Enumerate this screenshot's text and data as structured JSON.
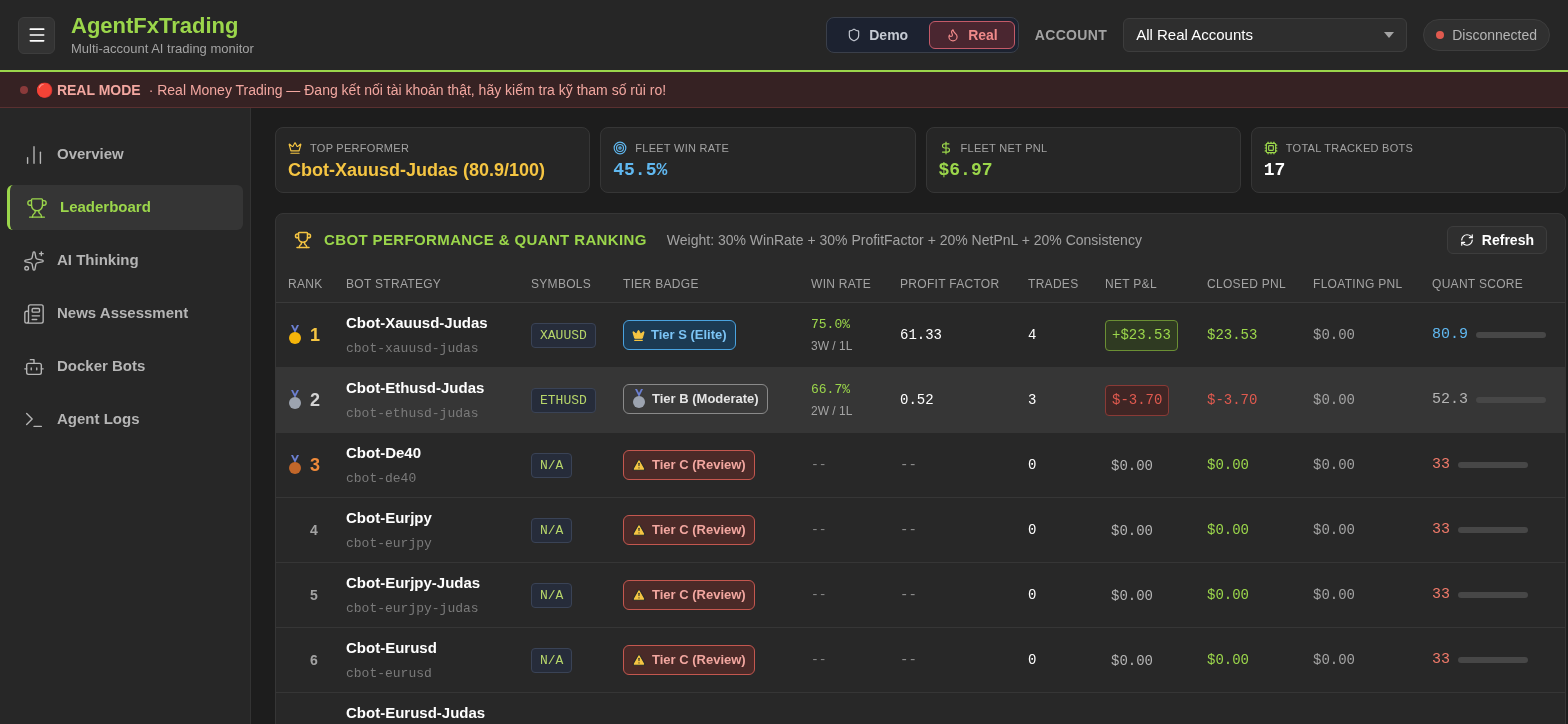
{
  "app": {
    "title": "AgentFxTrading",
    "subtitle": "Multi-account AI trading monitor"
  },
  "mode_toggle": [
    {
      "label": "Demo",
      "kind": "demo",
      "selected": false
    },
    {
      "label": "Real",
      "kind": "real",
      "selected": true
    }
  ],
  "account": {
    "label": "ACCOUNT",
    "value": "All Real Accounts"
  },
  "connection": {
    "label": "Disconnected",
    "connected": false
  },
  "banner": {
    "title": "🔴 REAL MODE",
    "text": "· Real Money Trading — Đang kết nối tài khoản thật, hãy kiểm tra kỹ tham số rủi ro!"
  },
  "sidebar": {
    "items": [
      {
        "label": "Overview",
        "kind": "chart",
        "selected": false
      },
      {
        "label": "Leaderboard",
        "kind": "trophy",
        "selected": true
      },
      {
        "label": "AI Thinking",
        "kind": "sparkles",
        "selected": false
      },
      {
        "label": "News Assessment",
        "kind": "news",
        "selected": false
      },
      {
        "label": "Docker Bots",
        "kind": "bot",
        "selected": false
      },
      {
        "label": "Agent Logs",
        "kind": "terminal",
        "selected": false
      }
    ]
  },
  "stats": [
    {
      "label": "TOP PERFORMER",
      "value": "Cbot-Xauusd-Judas (80.9/100)",
      "kind": "crown"
    },
    {
      "label": "FLEET WIN RATE",
      "value": "45.5%",
      "kind": "target"
    },
    {
      "label": "FLEET NET PNL",
      "value": "$6.97",
      "kind": "dollar"
    },
    {
      "label": "TOTAL TRACKED BOTS",
      "value": "17",
      "kind": "chip"
    }
  ],
  "ranking": {
    "title": "CBOT PERFORMANCE & QUANT RANKING",
    "weight_note": "Weight: 30% WinRate + 30% ProfitFactor + 20% NetPnL + 20% Consistency",
    "refresh_button": "Refresh",
    "columns": [
      "RANK",
      "BOT STRATEGY",
      "SYMBOLS",
      "TIER BADGE",
      "WIN RATE",
      "PROFIT FACTOR",
      "TRADES",
      "NET P&L",
      "CLOSED PNL",
      "FLOATING PNL",
      "QUANT SCORE"
    ],
    "rows": [
      {
        "rank": "1",
        "kind": "gold",
        "selected": false,
        "name": "Cbot-Xauusd-Judas",
        "slug": "cbot-xauusd-judas",
        "symbol": "XAUUSD",
        "tier": {
          "label": "Tier S (Elite)",
          "kind": "elite"
        },
        "win_rate": "75.0%",
        "record": "3W / 1L",
        "profit_factor": "61.33",
        "trades": "4",
        "net_pnl": {
          "text": "+$23.53",
          "kind": "gain"
        },
        "closed_pnl": {
          "text": "$23.53",
          "kind": "gain"
        },
        "floating_pnl": "$0.00",
        "score": {
          "text": "80.9",
          "kind": "high"
        }
      },
      {
        "rank": "2",
        "kind": "silver",
        "selected": true,
        "name": "Cbot-Ethusd-Judas",
        "slug": "cbot-ethusd-judas",
        "symbol": "ETHUSD",
        "tier": {
          "label": "Tier B (Moderate)",
          "kind": "moderate"
        },
        "win_rate": "66.7%",
        "record": "2W / 1L",
        "profit_factor": "0.52",
        "trades": "3",
        "net_pnl": {
          "text": "$-3.70",
          "kind": "loss"
        },
        "closed_pnl": {
          "text": "$-3.70",
          "kind": "loss"
        },
        "floating_pnl": "$0.00",
        "score": {
          "text": "52.3",
          "kind": "mid"
        }
      },
      {
        "rank": "3",
        "kind": "bronze",
        "selected": false,
        "name": "Cbot-De40",
        "slug": "cbot-de40",
        "symbol": "N/A",
        "tier": {
          "label": "Tier C (Review)",
          "kind": "review"
        },
        "win_rate": "--",
        "profit_factor": "--",
        "trades": "0",
        "net_pnl": {
          "text": "$0.00",
          "kind": "flat"
        },
        "closed_pnl": {
          "text": "$0.00",
          "kind": "gain"
        },
        "floating_pnl": "$0.00",
        "score": {
          "text": "33",
          "kind": "low"
        }
      },
      {
        "rank": "4",
        "kind": "plain",
        "selected": false,
        "name": "Cbot-Eurjpy",
        "slug": "cbot-eurjpy",
        "symbol": "N/A",
        "tier": {
          "label": "Tier C (Review)",
          "kind": "review"
        },
        "win_rate": "--",
        "profit_factor": "--",
        "trades": "0",
        "net_pnl": {
          "text": "$0.00",
          "kind": "flat"
        },
        "closed_pnl": {
          "text": "$0.00",
          "kind": "gain"
        },
        "floating_pnl": "$0.00",
        "score": {
          "text": "33",
          "kind": "low"
        }
      },
      {
        "rank": "5",
        "kind": "plain",
        "selected": false,
        "name": "Cbot-Eurjpy-Judas",
        "slug": "cbot-eurjpy-judas",
        "symbol": "N/A",
        "tier": {
          "label": "Tier C (Review)",
          "kind": "review"
        },
        "win_rate": "--",
        "profit_factor": "--",
        "trades": "0",
        "net_pnl": {
          "text": "$0.00",
          "kind": "flat"
        },
        "closed_pnl": {
          "text": "$0.00",
          "kind": "gain"
        },
        "floating_pnl": "$0.00",
        "score": {
          "text": "33",
          "kind": "low"
        }
      },
      {
        "rank": "6",
        "kind": "plain",
        "selected": false,
        "name": "Cbot-Eurusd",
        "slug": "cbot-eurusd",
        "symbol": "N/A",
        "tier": {
          "label": "Tier C (Review)",
          "kind": "review"
        },
        "win_rate": "--",
        "profit_factor": "--",
        "trades": "0",
        "net_pnl": {
          "text": "$0.00",
          "kind": "flat"
        },
        "closed_pnl": {
          "text": "$0.00",
          "kind": "gain"
        },
        "floating_pnl": "$0.00",
        "score": {
          "text": "33",
          "kind": "low"
        }
      },
      {
        "selected": false,
        "name": "Cbot-Eurusd-Judas"
      }
    ]
  }
}
